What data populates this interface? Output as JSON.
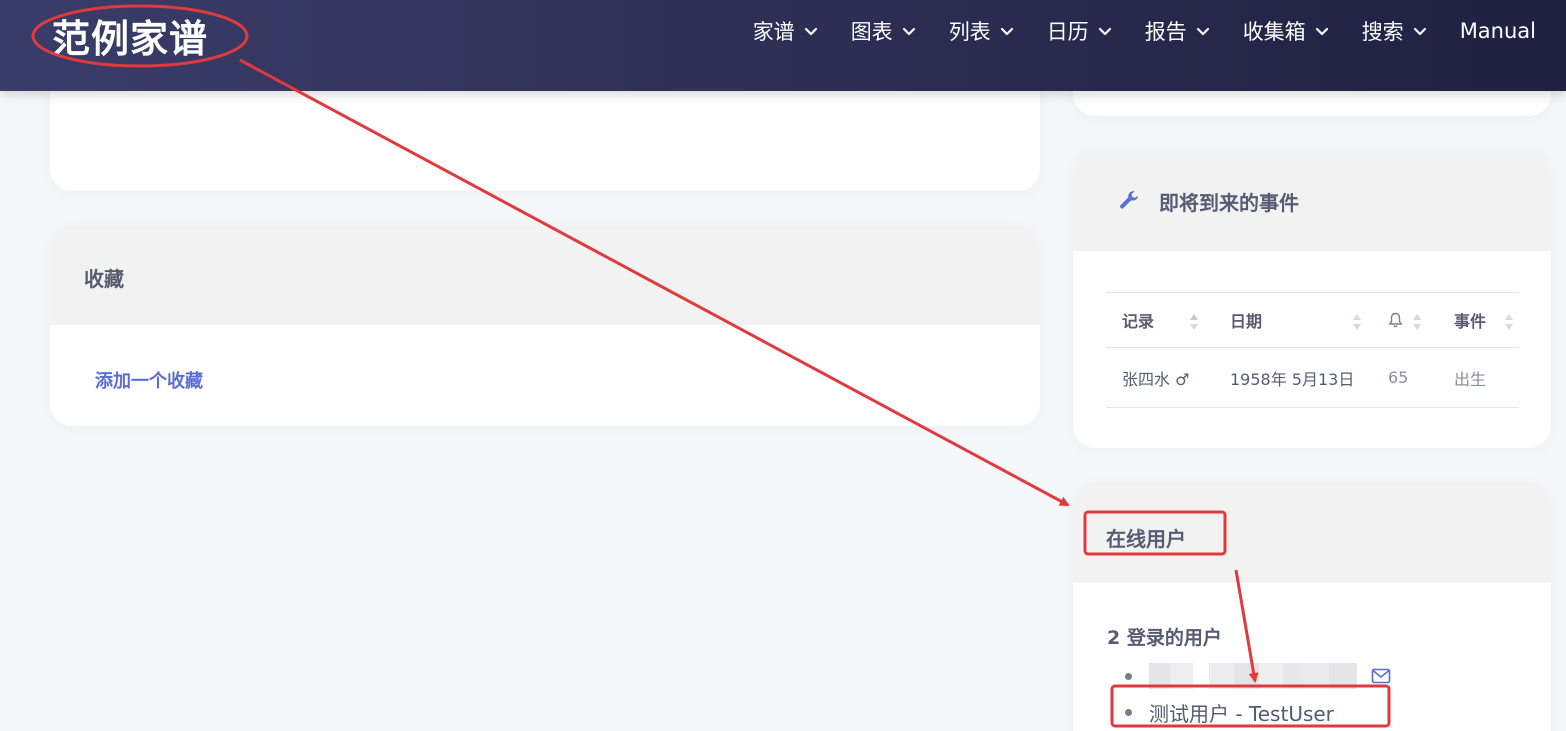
{
  "header": {
    "site_title": "范例家谱",
    "nav": [
      {
        "label": "家谱",
        "icon": "chevron-down-icon"
      },
      {
        "label": "图表",
        "icon": "chevron-down-icon"
      },
      {
        "label": "列表",
        "icon": "chevron-down-icon"
      },
      {
        "label": "日历",
        "icon": "chevron-down-icon"
      },
      {
        "label": "报告",
        "icon": "chevron-down-icon"
      },
      {
        "label": "收集箱",
        "icon": "chevron-down-icon"
      },
      {
        "label": "搜索",
        "icon": "chevron-down-icon"
      },
      {
        "label": "Manual",
        "icon": ""
      }
    ]
  },
  "favorites": {
    "title": "收藏",
    "add_link": "添加一个收藏"
  },
  "upcoming_events": {
    "icon": "wrench-icon",
    "title": "即将到来的事件",
    "columns": [
      {
        "label": "记录",
        "sortable": true
      },
      {
        "label": "日期",
        "sortable": true
      },
      {
        "label": "",
        "icon": "bell-icon",
        "sortable": true
      },
      {
        "label": "事件",
        "sortable": true
      }
    ],
    "rows": [
      {
        "record": "张四水 ♂",
        "date": "1958年 5月13日",
        "years": "65",
        "event": "出生"
      }
    ]
  },
  "online_users": {
    "title": "在线用户",
    "logged_in_label": "2 登录的用户",
    "users": [
      {
        "name": "",
        "redacted": true,
        "icon": "mail-icon"
      },
      {
        "name": "测试用户 - TestUser",
        "redacted": false
      }
    ]
  },
  "colors": {
    "header_start": "#3a3d69",
    "header_end": "#1f2142",
    "link": "#5b6dd6",
    "annotation": "#e0393e",
    "card_head": "#f2f2f3"
  }
}
